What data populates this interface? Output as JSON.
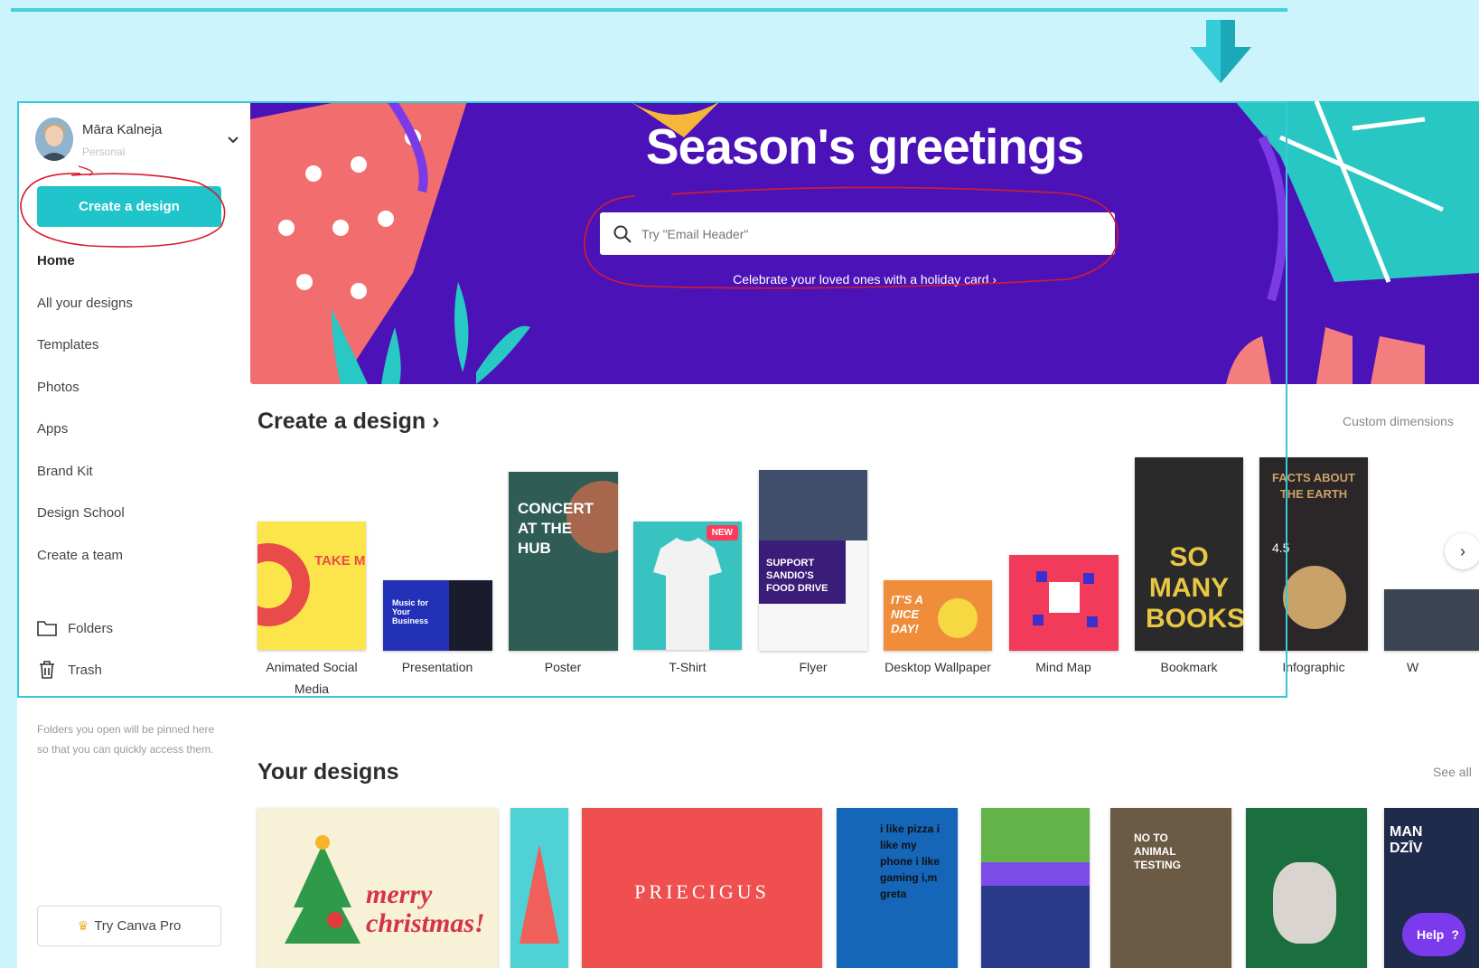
{
  "profile": {
    "name": "Māra Kalneja",
    "plan": "Personal"
  },
  "sidebar": {
    "create_button": "Create a design",
    "nav": [
      "Home",
      "All your designs",
      "Templates",
      "Photos",
      "Apps",
      "Brand Kit",
      "Design School",
      "Create a team"
    ],
    "folders": "Folders",
    "trash": "Trash",
    "folders_note": "Folders you open will be pinned here so that you can quickly access them.",
    "pro_button": "Try Canva Pro"
  },
  "hero": {
    "title": "Season's greetings",
    "search_placeholder": "Try \"Email Header\"",
    "link": "Celebrate your loved ones with a holiday card ›"
  },
  "create_section": {
    "title": "Create a design ›",
    "custom_link": "Custom dimensions",
    "items": [
      {
        "label": "Animated Social Media",
        "art": "TAKE ME TO THE OCEAN"
      },
      {
        "label": "Presentation",
        "art": "Music for Your Business"
      },
      {
        "label": "Poster",
        "art": "CONCERT AT THE HUB"
      },
      {
        "label": "T-Shirt",
        "badge": "NEW"
      },
      {
        "label": "Flyer",
        "art": "SUPPORT SANDIO'S FOOD DRIVE"
      },
      {
        "label": "Desktop Wallpaper",
        "art": "IT'S A NICE DAY!"
      },
      {
        "label": "Mind Map"
      },
      {
        "label": "Bookmark",
        "art": "SO MANY BOOKS"
      },
      {
        "label": "Infographic",
        "art": "FACTS ABOUT THE EARTH",
        "art_value": "4.5"
      },
      {
        "label": "W"
      }
    ]
  },
  "your_designs": {
    "title": "Your designs",
    "see_all": "See all",
    "items": [
      {
        "art": "merry christmas!"
      },
      {
        "art": ""
      },
      {
        "art": "PRIECIGUS"
      },
      {
        "art": "i like pizza i like my phone i like gaming i,m greta"
      },
      {
        "art": ""
      },
      {
        "art": "NO TO ANIMAL TESTING"
      },
      {
        "art": ""
      },
      {
        "art": "MAN DZĪV"
      }
    ]
  },
  "help": {
    "label": "Help",
    "icon": "?"
  },
  "colors": {
    "accent": "#20c4cb",
    "hero": "#4b13b7",
    "annotation": "#d61b2b"
  }
}
